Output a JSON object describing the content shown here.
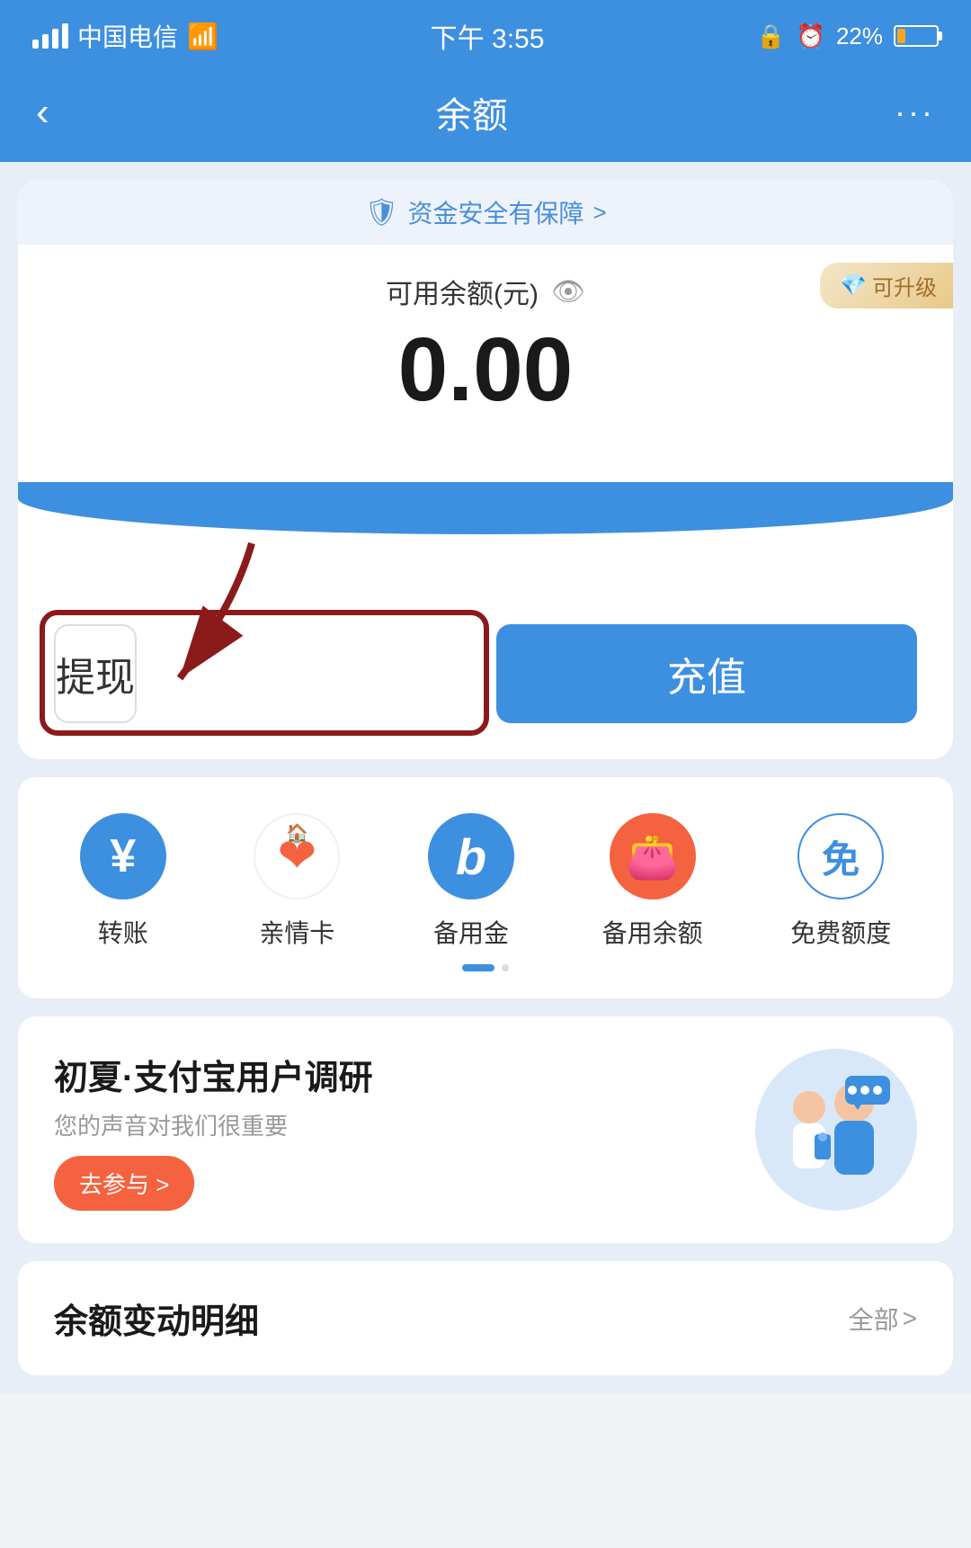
{
  "status_bar": {
    "carrier": "中国电信",
    "time": "下午 3:55",
    "battery_percent": "22%"
  },
  "nav": {
    "back_label": "‹",
    "title": "余额",
    "more_label": "···"
  },
  "security": {
    "text": "资金安全有保障",
    "arrow": ">"
  },
  "balance": {
    "label": "可用余额(元)",
    "amount": "0.00",
    "upgrade_label": "可升级"
  },
  "actions": {
    "withdraw_label": "提现",
    "recharge_label": "充值"
  },
  "quick_actions": [
    {
      "id": "transfer",
      "label": "转账",
      "icon": "¥",
      "color": "blue"
    },
    {
      "id": "family_card",
      "label": "亲情卡",
      "icon": "♥",
      "color": "orange-heart"
    },
    {
      "id": "reserve",
      "label": "备用金",
      "icon": "b",
      "color": "blue"
    },
    {
      "id": "reserve_balance",
      "label": "备用余额",
      "icon": "👛",
      "color": "orange-bg"
    },
    {
      "id": "free_quota",
      "label": "免费额度",
      "icon": "免",
      "color": "blue"
    }
  ],
  "survey": {
    "title": "初夏·支付宝用户调研",
    "subtitle": "您的声音对我们很重要",
    "btn_label": "去参与 >"
  },
  "transaction": {
    "title": "余额变动明细",
    "all_label": "全部",
    "all_arrow": ">"
  }
}
